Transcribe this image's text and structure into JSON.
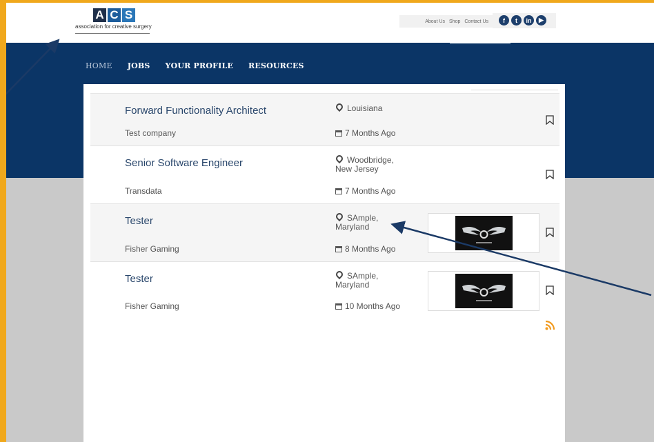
{
  "logo": {
    "letters": [
      "A",
      "C",
      "S"
    ],
    "tagline": "association for creative surgery"
  },
  "toplinks": [
    "About Us",
    "Shop",
    "Contact Us"
  ],
  "social": [
    {
      "icon": "facebook-icon",
      "glyph": "f"
    },
    {
      "icon": "twitter-icon",
      "glyph": "t"
    },
    {
      "icon": "linkedin-icon",
      "glyph": "in"
    },
    {
      "icon": "youtube-icon",
      "glyph": "▶"
    }
  ],
  "nav": [
    "HOME",
    "JOBS",
    "YOUR PROFILE",
    "RESOURCES"
  ],
  "jobs": [
    {
      "title": "Forward Functionality Architect",
      "company": "Test company",
      "location": "Louisiana",
      "posted": "7 Months Ago",
      "has_logo": false
    },
    {
      "title": "Senior Software Engineer",
      "company": "Transdata",
      "location": "Woodbridge, New Jersey",
      "posted": "7 Months Ago",
      "has_logo": false
    },
    {
      "title": "Tester",
      "company": "Fisher Gaming",
      "location": "SAmple, Maryland",
      "posted": "8 Months Ago",
      "has_logo": true
    },
    {
      "title": "Tester",
      "company": "Fisher Gaming",
      "location": "SAmple, Maryland",
      "posted": "10 Months Ago",
      "has_logo": true
    }
  ],
  "colors": {
    "frame": "#f0a81c",
    "nav_band": "#0b3566",
    "title": "#29466b",
    "rss": "#f29a1d",
    "arrow": "#1b3a66"
  }
}
